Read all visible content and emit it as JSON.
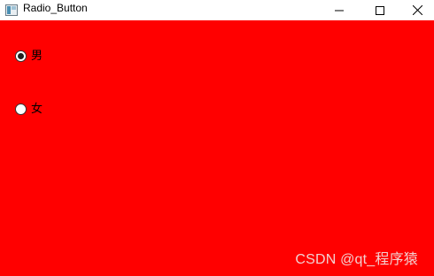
{
  "window": {
    "title": "Radio_Button",
    "app_icon": "qt-app-icon",
    "background_color": "#ff0000"
  },
  "controls": {
    "minimize_icon": "minimize-icon",
    "maximize_icon": "maximize-icon",
    "close_icon": "close-icon"
  },
  "radios": [
    {
      "label": "男",
      "checked": true
    },
    {
      "label": "女",
      "checked": false
    }
  ],
  "watermark": "CSDN @qt_程序猿"
}
